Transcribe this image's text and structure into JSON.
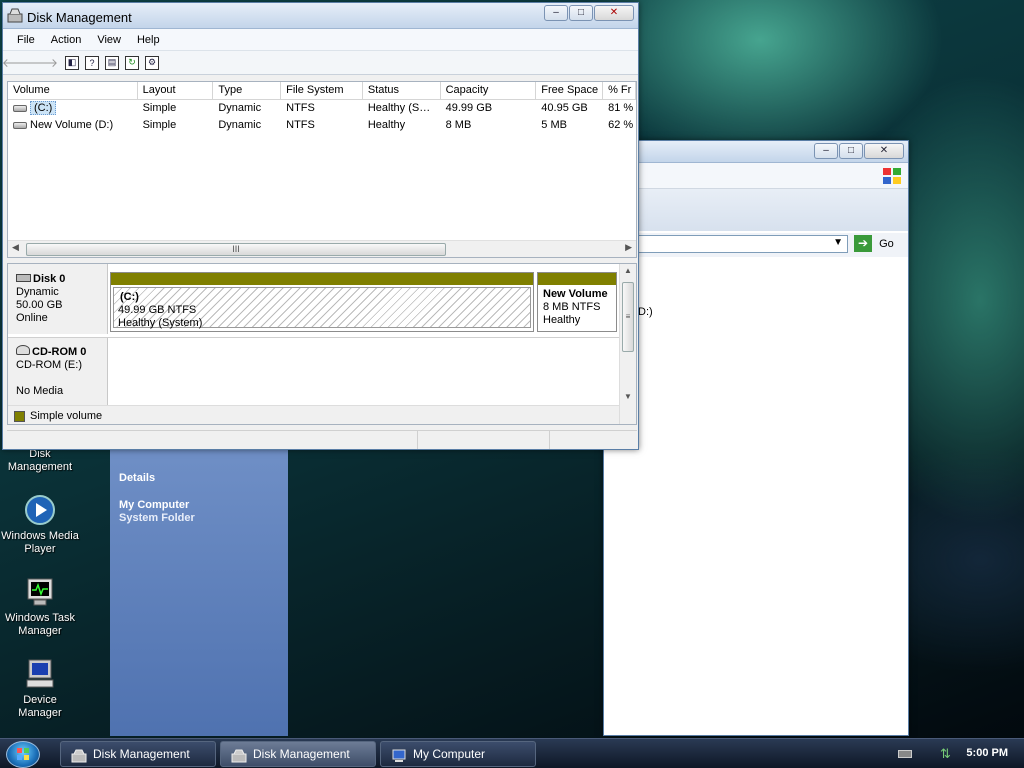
{
  "desktop": {
    "icons": [
      {
        "label": "Disk\nManagement"
      },
      {
        "label": "Windows Media Player"
      },
      {
        "label": "Windows Task Manager"
      },
      {
        "label": "Device Manager"
      }
    ]
  },
  "disk_management": {
    "title": "Disk Management",
    "menu": [
      "File",
      "Action",
      "View",
      "Help"
    ],
    "columns": [
      "Volume",
      "Layout",
      "Type",
      "File System",
      "Status",
      "Capacity",
      "Free Space",
      "% Fr"
    ],
    "rows": [
      [
        "(C:)",
        "Simple",
        "Dynamic",
        "NTFS",
        "Healthy (S…",
        "49.99 GB",
        "40.95 GB",
        "81 %"
      ],
      [
        "New Volume (D:)",
        "Simple",
        "Dynamic",
        "NTFS",
        "Healthy",
        "8 MB",
        "5 MB",
        "62 %"
      ]
    ],
    "disks": [
      {
        "name": "Disk 0",
        "type": "Dynamic",
        "size": "50.00 GB",
        "state": "Online"
      },
      {
        "name": "CD-ROM 0",
        "type": "CD-ROM (E:)",
        "size": "",
        "state": "No Media"
      }
    ],
    "partitions": [
      {
        "name": "(C:)",
        "size": "49.99 GB NTFS",
        "status": "Healthy (System)"
      },
      {
        "name": "New Volume",
        "size": "8 MB NTFS",
        "status": "Healthy"
      }
    ],
    "legend": "Simple volume",
    "scroll_grip": "III",
    "colors": {
      "simple_volume": "#808000"
    }
  },
  "my_computer": {
    "go": "Go",
    "partial_text": "D:)",
    "details_header": "Details",
    "item_name": "My Computer",
    "item_type": "System Folder"
  },
  "taskbar": {
    "tasks": [
      "Disk Management",
      "Disk Management",
      "My Computer"
    ],
    "clock": "5:00 PM"
  }
}
